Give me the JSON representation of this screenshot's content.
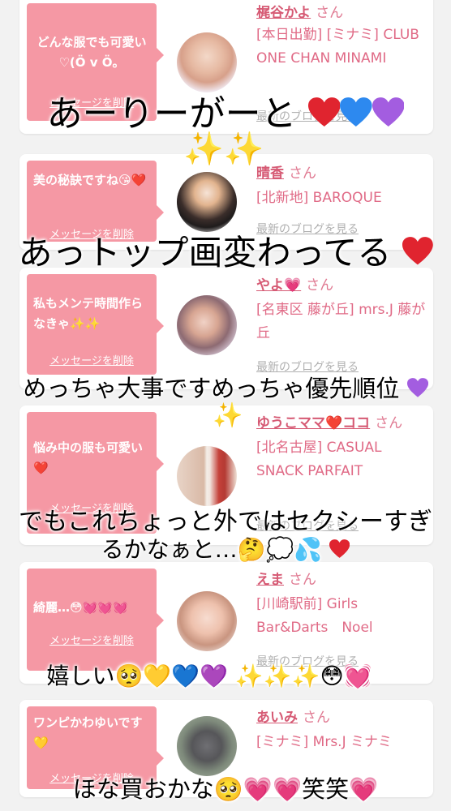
{
  "cards": [
    {
      "message": "どんな服でも可愛い♡(Ö v Ö。",
      "delete_label": "メッセージを削除",
      "name": "梶谷かよ",
      "honorific": "さん",
      "shop": "[本日出勤] [ミナミ] CLUB ONE CHAN MINAMI",
      "blog_label": "最新のブログを見る"
    },
    {
      "message": "美の秘訣ですね😘❤️",
      "delete_label": "メッセージを削除",
      "name": "晴香",
      "honorific": "さん",
      "shop": "[北新地] BAROQUE",
      "blog_label": "最新のブログを見る"
    },
    {
      "message": "私もメンテ時間作らなきゃ✨✨",
      "delete_label": "メッセージを削除",
      "name": "やよ💗",
      "honorific": "さん",
      "shop": "[名東区 藤が丘] mrs.J 藤が丘",
      "blog_label": "最新のブログを見る"
    },
    {
      "message": "悩み中の服も可愛い❤️",
      "delete_label": "メッセージを削除",
      "name": "ゆうこママ❤️ココ",
      "honorific": "さん",
      "shop": "[北名古屋] CASUAL SNACK PARFAIT",
      "blog_label": "最新のブログを見る"
    },
    {
      "message": "綺麗…😳💓💓💓",
      "delete_label": "メッセージを削除",
      "name": "えま",
      "honorific": "さん",
      "shop": "[川崎駅前] Girls Bar&Darts　Noel",
      "blog_label": "最新のブログを見る"
    },
    {
      "message": "ワンピかわゆいです💛",
      "delete_label": "メッセージを削除",
      "name": "あいみ",
      "honorific": "さん",
      "shop": "[ミナミ] Mrs.J ミナミ",
      "blog_label": "最新のブログを見る"
    }
  ],
  "captions": [
    "あーりーがーと",
    "あっトップ画変わってる",
    "めっちゃ大事ですめっちゃ優先順位",
    "でもこれちょっと外ではセクシーすぎ",
    "るかなぁと…🤔💭💦",
    "嬉しい🥺💛💙💜",
    "ほな買おかな🥺💗💗笑笑💗"
  ],
  "colors": {
    "bubble": "#f598a4",
    "name": "#d65a74",
    "shop": "#e06a86",
    "blog": "#b0b0b0",
    "background": "#f2f2f2"
  }
}
